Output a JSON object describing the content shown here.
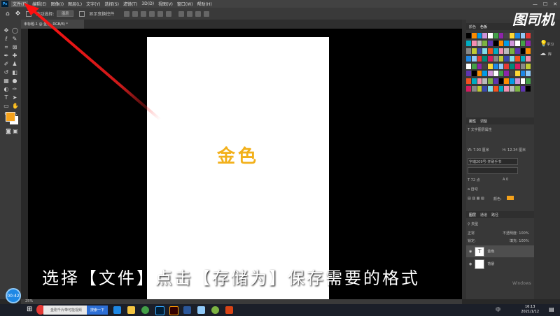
{
  "menu": {
    "app_icon": "Ps",
    "items": [
      "文件(F)",
      "编辑(E)",
      "图像(I)",
      "图层(L)",
      "文字(Y)",
      "选择(S)",
      "滤镜(T)",
      "3D(D)",
      "视图(V)",
      "窗口(W)",
      "帮助(H)"
    ],
    "active_item": "文件(F)"
  },
  "options": {
    "auto_select_label": "自动选择:",
    "auto_select_value": "图层",
    "transform_label": "显示变换控件"
  },
  "document_tab": "未标题-1 @ 金色, RGB/8) *",
  "canvas": {
    "text": "金色",
    "text_color": "#f2b01a"
  },
  "subtitle": "选择【文件】点击【存储为】保存需要的格式",
  "watermark": "图司机",
  "panels": {
    "swatches_tabs": [
      "颜色",
      "色板"
    ],
    "learn_label": "学习",
    "library_label": "库",
    "properties_tabs": [
      "属性",
      "调整"
    ],
    "properties_title": "文字图层属性",
    "w_value": "7.93 厘米",
    "h_value": "12.34 厘米",
    "font_name": "字魂209号-并刷手书",
    "font_size": "72 点",
    "aa_mode": "自动",
    "leading": "0",
    "color_label": "颜色:",
    "color_value": "#f5a21b",
    "layers_tabs": [
      "图层",
      "通道",
      "路径"
    ],
    "layer_filter": "类型",
    "blend_mode": "正常",
    "opacity_label": "不透明度:",
    "opacity_value": "100%",
    "lock_label": "锁定:",
    "fill_label": "填充:",
    "fill_value": "100%",
    "layers": [
      {
        "name": "金色",
        "kind": "T"
      },
      {
        "name": "背景",
        "kind": ""
      }
    ]
  },
  "status": {
    "zoom": "25%"
  },
  "taskbar": {
    "timer": "00:42",
    "search_placeholder": "金刚千片带可能视频",
    "search_button": "搜索一下",
    "time": "16:13",
    "date": "2021/1/12",
    "ime": "中"
  },
  "windows_text": "Windows"
}
